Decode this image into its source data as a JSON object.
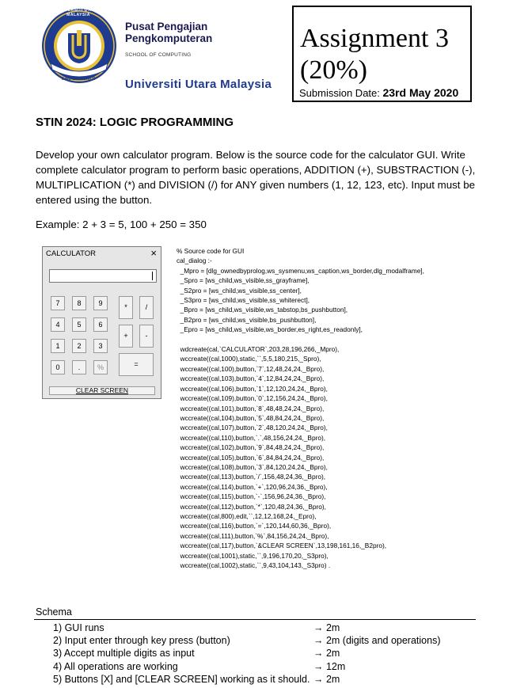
{
  "header": {
    "logo": {
      "ring_top": "UNIVERSITI UTARA MALAYSIA",
      "banner": "ILMU BUDI BAKTI"
    },
    "org_line1": "Pusat Pengajian",
    "org_line2": "Pengkomputeran",
    "school": "SCHOOL OF COMPUTING",
    "university": "Universiti Utara Malaysia",
    "assignment_line1": "Assignment 3",
    "assignment_line2": "(20%)",
    "submission_label": "Submission Date: ",
    "submission_date": "23rd May 2020"
  },
  "course_title": "STIN 2024: LOGIC PROGRAMMING",
  "description": [
    "Develop your own calculator program.  Below is the source code for the calculator GUI.  Write",
    "complete calculator program to perform basic operations, ADDITION (+), SUBSTRACTION (-),",
    "MULTIPLICATION (*) and DIVISION (/) for ANY given numbers (1, 12, 123, etc).  Input must be",
    "entered using the button."
  ],
  "example": "Example: 2 + 3 = 5, 100 + 250 = 350",
  "calculator": {
    "title": "CALCULATOR",
    "close": "×",
    "edit_value": "",
    "clear_label": "CLEAR SCREEN",
    "buttons": {
      "b7": "7",
      "b8": "8",
      "b9": "9",
      "mul": "*",
      "div": "/",
      "b4": "4",
      "b5": "5",
      "b6": "6",
      "plus": "+",
      "minus": "-",
      "b1": "1",
      "b2": "2",
      "b3": "3",
      "b0": "0",
      "dot": ".",
      "pct": "%",
      "eq": "="
    }
  },
  "code_lines": [
    "% Source code for GUI",
    "cal_dialog :-",
    "  _Mpro = [dlg_ownedbyprolog,ws_sysmenu,ws_caption,ws_border,dlg_modalframe],",
    "  _Spro = [ws_child,ws_visible,ss_grayframe],",
    "  _S2pro = [ws_child,ws_visible,ss_center],",
    "  _S3pro = [ws_child,ws_visible,ss_whiterect],",
    "  _Bpro = [ws_child,ws_visible,ws_tabstop,bs_pushbutton],",
    "  _B2pro = [ws_child,ws_visible,bs_pushbutton],",
    "  _Epro = [ws_child,ws_visible,ws_border,es_right,es_readonly],",
    "",
    "  wdcreate(cal,`CALCULATOR`,203,28,196,266,_Mpro),",
    "  wccreate((cal,1000),static,``,5,5,180,215,_Spro),",
    "  wccreate((cal,100),button,`7`,12,48,24,24,_Bpro),",
    "  wccreate((cal,103),button,`4`,12,84,24,24,_Bpro),",
    "  wccreate((cal,106),button,`1`,12,120,24,24,_Bpro),",
    "  wccreate((cal,109),button,`0`,12,156,24,24,_Bpro),",
    "  wccreate((cal,101),button,`8`,48,48,24,24,_Bpro),",
    "  wccreate((cal,104),button,`5`,48,84,24,24,_Bpro),",
    "  wccreate((cal,107),button,`2`,48,120,24,24,_Bpro),",
    "  wccreate((cal,110),button,`.`,48,156,24,24,_Bpro),",
    "  wccreate((cal,102),button,`9`,84,48,24,24,_Bpro),",
    "  wccreate((cal,105),button,`6`,84,84,24,24,_Bpro),",
    "  wccreate((cal,108),button,`3`,84,120,24,24,_Bpro),",
    "  wccreate((cal,113),button,`/`,156,48,24,36,_Bpro),",
    "  wccreate((cal,114),button,`+`,120,96,24,36,_Bpro),",
    "  wccreate((cal,115),button,`-`,156,96,24,36,_Bpro),",
    "  wccreate((cal,112),button,`*`,120,48,24,36,_Bpro),",
    "  wccreate((cal,800),edit,``,12,12,168,24,_Epro),",
    "  wccreate((cal,116),button,`=`,120,144,60,36,_Bpro),",
    "  wccreate((cal,111),button,`%`,84,156,24,24,_Bpro),",
    "  wccreate((cal,117),button,`&CLEAR SCREEN`,13,198,161,16,_B2pro),",
    "  wccreate((cal,1001),static,``,9,196,170,20,_S3pro),",
    "  wccreate((cal,1002),static,``,9,43,104,143,_S3pro) ."
  ],
  "schema": {
    "title": "Schema",
    "items": [
      {
        "num": "1)",
        "text": "GUI runs",
        "points": "→ 2m"
      },
      {
        "num": "2)",
        "text": "Input enter through key press (button)",
        "points": "→ 2m (digits and operations)"
      },
      {
        "num": "3)",
        "text": "Accept multiple digits as input",
        "points": "→ 2m"
      },
      {
        "num": "4)",
        "text": "All operations are working",
        "points": "→ 12m"
      },
      {
        "num": "5)",
        "text": "Buttons [X] and [CLEAR SCREEN] working as it should.",
        "points": "→ 2m"
      }
    ]
  }
}
